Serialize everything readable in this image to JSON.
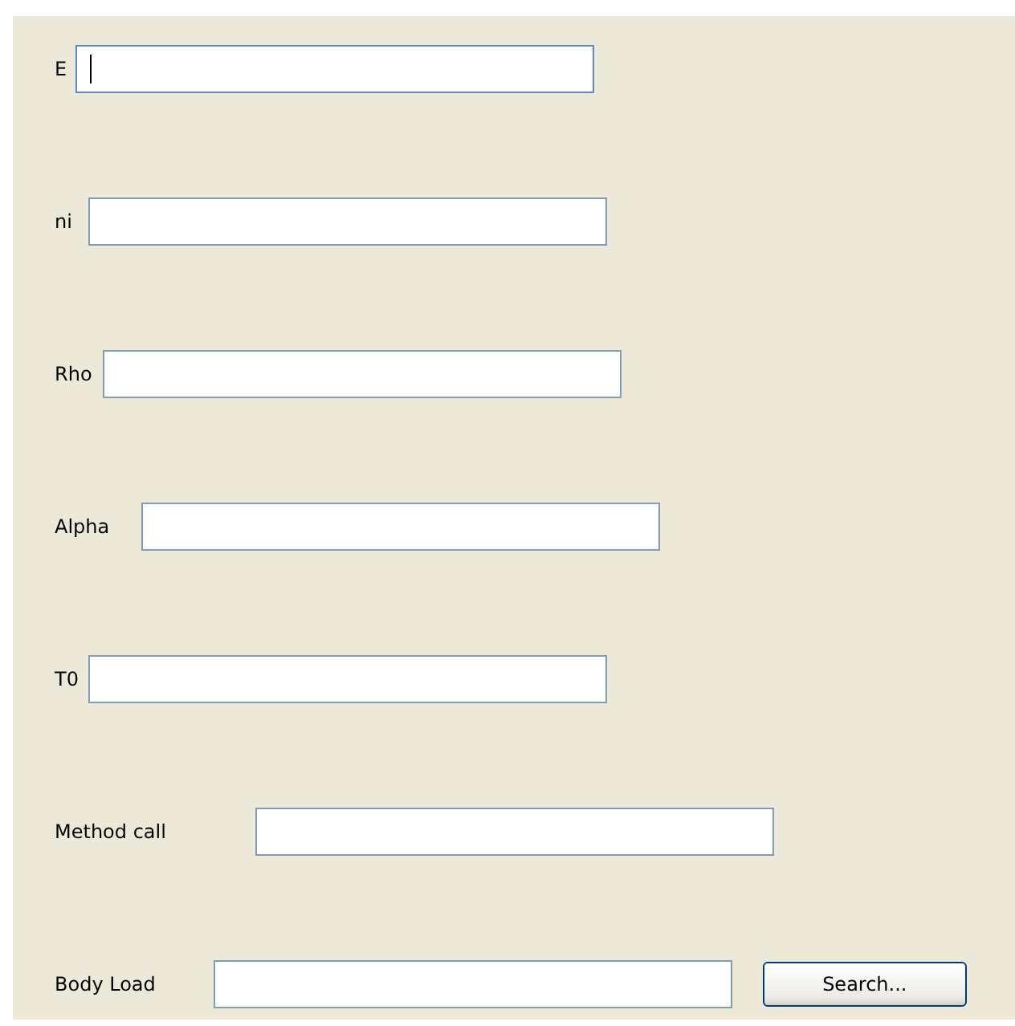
{
  "fields": [
    {
      "label": "E",
      "focused": true
    },
    {
      "label": "ni",
      "focused": false
    },
    {
      "label": "Rho",
      "focused": false
    },
    {
      "label": "Alpha",
      "focused": false
    },
    {
      "label": "T0",
      "focused": false
    },
    {
      "label": "Method call",
      "focused": false
    }
  ],
  "body_load": {
    "label": "Body Load",
    "button": "Search..."
  }
}
